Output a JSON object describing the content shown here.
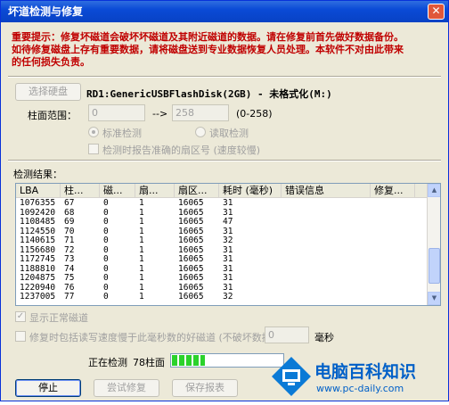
{
  "window": {
    "title": "坏道检测与修复",
    "close_label": "✕"
  },
  "warning": {
    "line1": "重要提示：修复坏磁道会破坏坏磁道及其附近磁道的数据。请在修复前首先做好数据备份。",
    "line2": "如待修复磁盘上存有重要数据，请将磁盘送到专业数据恢复人员处理。本软件不对由此带来",
    "line3": "的任何损失负责。"
  },
  "disk": {
    "select_button": "选择硬盘",
    "name": "RD1:GenericUSBFlashDisk(2GB) - 未格式化(M:)"
  },
  "range": {
    "label": "柱面范围：",
    "from_value": "0",
    "arrow": "-->",
    "to_value": "258",
    "hint": "(0-258)"
  },
  "options": {
    "standard_check": "标准检测",
    "read_check": "读取检测",
    "report_sector": "检测时报告准确的扇区号 (速度较慢)"
  },
  "results": {
    "label": "检测结果：",
    "columns": [
      "LBA",
      "柱...",
      "磁...",
      "扇...",
      "扇区...",
      "耗时 (毫秒)",
      "错误信息",
      "修复..."
    ],
    "rows": [
      [
        "1076355",
        "67",
        "0",
        "1",
        "16065",
        "31",
        "",
        ""
      ],
      [
        "1092420",
        "68",
        "0",
        "1",
        "16065",
        "31",
        "",
        ""
      ],
      [
        "1108485",
        "69",
        "0",
        "1",
        "16065",
        "47",
        "",
        ""
      ],
      [
        "1124550",
        "70",
        "0",
        "1",
        "16065",
        "31",
        "",
        ""
      ],
      [
        "1140615",
        "71",
        "0",
        "1",
        "16065",
        "32",
        "",
        ""
      ],
      [
        "1156680",
        "72",
        "0",
        "1",
        "16065",
        "31",
        "",
        ""
      ],
      [
        "1172745",
        "73",
        "0",
        "1",
        "16065",
        "31",
        "",
        ""
      ],
      [
        "1188810",
        "74",
        "0",
        "1",
        "16065",
        "31",
        "",
        ""
      ],
      [
        "1204875",
        "75",
        "0",
        "1",
        "16065",
        "31",
        "",
        ""
      ],
      [
        "1220940",
        "76",
        "0",
        "1",
        "16065",
        "31",
        "",
        ""
      ],
      [
        "1237005",
        "77",
        "0",
        "1",
        "16065",
        "32",
        "",
        ""
      ]
    ]
  },
  "show_normal": {
    "label": "显示正常磁道",
    "checked": true
  },
  "repair_slow": {
    "label": "修复时包括读写速度慢于此毫秒数的好磁道 (不破坏数据)：",
    "value": "0",
    "unit": "毫秒"
  },
  "status": {
    "text": "正在检测",
    "cylinder": "78柱面",
    "progress": 0.3
  },
  "buttons": {
    "stop": "停止",
    "try_repair": "尝试修复",
    "save_report": "保存报表"
  },
  "watermark": {
    "brand": "电脑百科知识",
    "url": "www.pc-daily.com"
  },
  "colors": {
    "warning": "#c00000",
    "progress": "#2bd22b",
    "title_bar": "#0a4ad6"
  }
}
